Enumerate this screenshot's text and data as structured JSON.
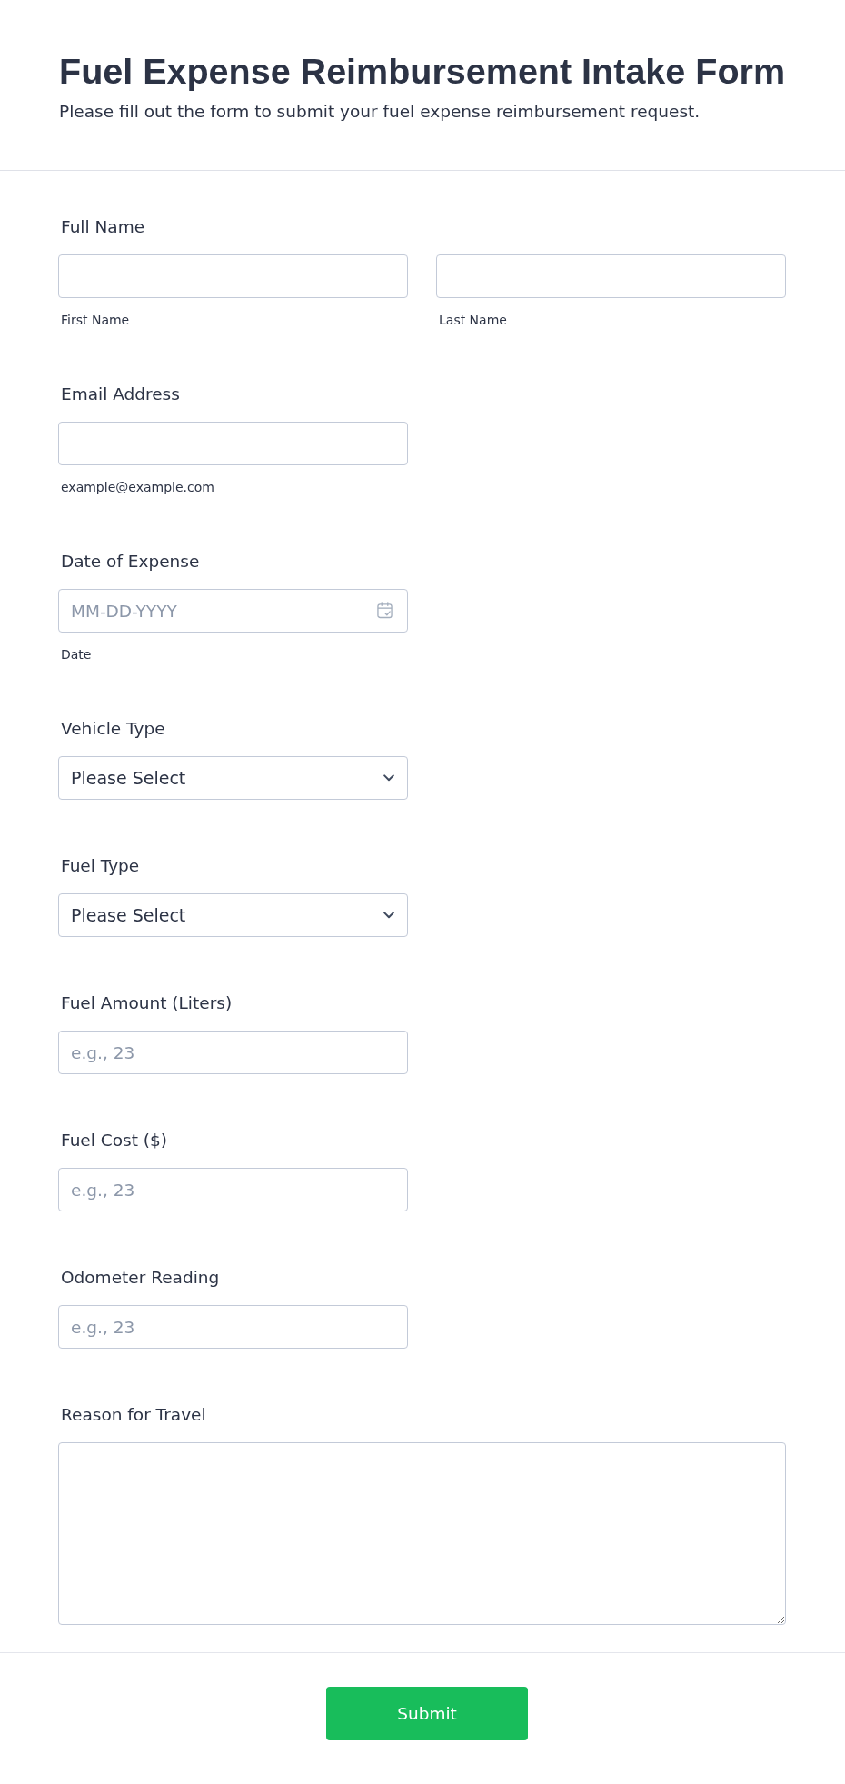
{
  "header": {
    "title": "Fuel Expense Reimbursement Intake Form",
    "subtitle": "Please fill out the form to submit your fuel expense reimbursement request."
  },
  "fields": [
    {
      "kind": "name",
      "label": "Full Name",
      "parts": [
        {
          "sublabel": "First Name"
        },
        {
          "sublabel": "Last Name"
        }
      ]
    },
    {
      "kind": "email",
      "label": "Email Address",
      "sublabel": "example@example.com"
    },
    {
      "kind": "date",
      "label": "Date of Expense",
      "placeholder": "MM-DD-YYYY",
      "sublabel": "Date"
    },
    {
      "kind": "select",
      "label": "Vehicle Type",
      "value": "Please Select"
    },
    {
      "kind": "select",
      "label": "Fuel Type",
      "value": "Please Select"
    },
    {
      "kind": "number",
      "label": "Fuel Amount (Liters)",
      "placeholder": "e.g., 23"
    },
    {
      "kind": "number",
      "label": "Fuel Cost ($)",
      "placeholder": "e.g., 23"
    },
    {
      "kind": "number",
      "label": "Odometer Reading",
      "placeholder": "e.g., 23"
    },
    {
      "kind": "textarea",
      "label": "Reason for Travel"
    }
  ],
  "submit": {
    "label": "Submit"
  }
}
